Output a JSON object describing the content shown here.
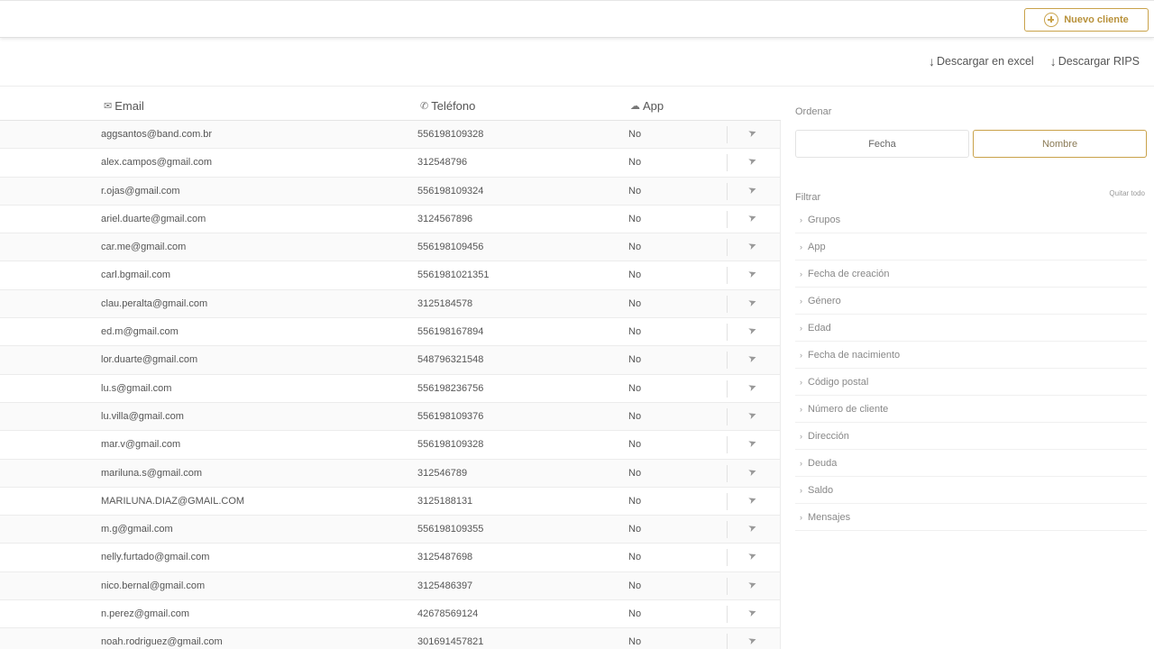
{
  "header": {
    "new_client_label": "Nuevo cliente"
  },
  "downloads": {
    "excel_label": "Descargar en excel",
    "rips_label": "Descargar RIPS"
  },
  "table": {
    "columns": {
      "email": "Email",
      "phone": "Teléfono",
      "app": "App"
    },
    "rows": [
      {
        "email": "aggsantos@band.com.br",
        "phone": "556198109328",
        "app": "No"
      },
      {
        "email": "alex.campos@gmail.com",
        "phone": "312548796",
        "app": "No"
      },
      {
        "email": "r.ojas@gmail.com",
        "phone": "556198109324",
        "app": "No"
      },
      {
        "email": "ariel.duarte@gmail.com",
        "phone": "3124567896",
        "app": "No"
      },
      {
        "email": "car.me@gmail.com",
        "phone": "556198109456",
        "app": "No"
      },
      {
        "email": "carl.bgmail.com",
        "phone": "5561981021351",
        "app": "No"
      },
      {
        "email": "clau.peralta@gmail.com",
        "phone": "3125184578",
        "app": "No"
      },
      {
        "email": "ed.m@gmail.com",
        "phone": "556198167894",
        "app": "No"
      },
      {
        "email": "lor.duarte@gmail.com",
        "phone": "548796321548",
        "app": "No"
      },
      {
        "email": "lu.s@gmail.com",
        "phone": "556198236756",
        "app": "No"
      },
      {
        "email": "lu.villa@gmail.com",
        "phone": "556198109376",
        "app": "No"
      },
      {
        "email": "mar.v@gmail.com",
        "phone": "556198109328",
        "app": "No"
      },
      {
        "email": "mariluna.s@gmail.com",
        "phone": "312546789",
        "app": "No"
      },
      {
        "email": "MARILUNA.DIAZ@GMAIL.COM",
        "phone": "3125188131",
        "app": "No"
      },
      {
        "email": "m.g@gmail.com",
        "phone": "556198109355",
        "app": "No"
      },
      {
        "email": "nelly.furtado@gmail.com",
        "phone": "3125487698",
        "app": "No"
      },
      {
        "email": "nico.bernal@gmail.com",
        "phone": "3125486397",
        "app": "No"
      },
      {
        "email": "n.perez@gmail.com",
        "phone": "42678569124",
        "app": "No"
      },
      {
        "email": "noah.rodriguez@gmail.com",
        "phone": "301691457821",
        "app": "No"
      }
    ]
  },
  "sidebar": {
    "sort_label": "Ordenar",
    "sort_options": [
      "Fecha",
      "Nombre"
    ],
    "sort_selected": "Nombre",
    "filter_label": "Filtrar",
    "clear_all_label": "Quitar todo",
    "filters": [
      "Grupos",
      "App",
      "Fecha de creación",
      "Género",
      "Edad",
      "Fecha de nacimiento",
      "Código postal",
      "Número de cliente",
      "Dirección",
      "Deuda",
      "Saldo",
      "Mensajes"
    ]
  },
  "icons": {
    "new_client": "plus-circle-icon",
    "download": "download-arrow-icon",
    "email": "mail-icon",
    "phone": "phone-icon",
    "app": "cloud-icon",
    "send": "paper-plane-icon",
    "chevron": "chevron-right-icon"
  },
  "colors": {
    "accent": "#c9a24a",
    "accent_text": "#b8913a"
  }
}
